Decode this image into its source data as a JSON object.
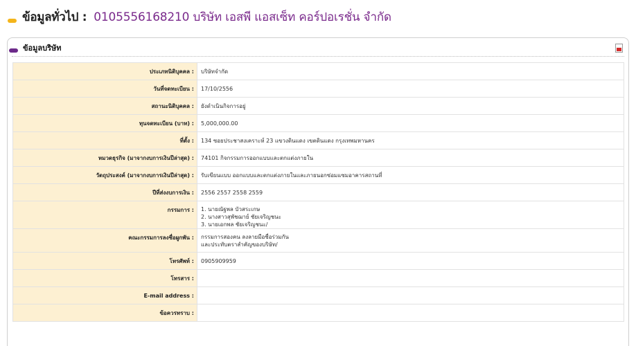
{
  "header": {
    "title": "ข้อมูลทั่วไป :",
    "company": "0105556168210  บริษัท เอสพี แอสเซ็ท คอร์ปอเรชั่น จำกัด"
  },
  "panel": {
    "title": "ข้อมูลบริษัท",
    "pdf_icon": "pdf-icon"
  },
  "rows": [
    {
      "label": "ประเภทนิติบุคคล :",
      "value": "บริษัทจำกัด"
    },
    {
      "label": "วันที่จดทะเบียน :",
      "value": "17/10/2556"
    },
    {
      "label": "สถานะนิติบุคคล :",
      "value": "ยังดำเนินกิจการอยู่"
    },
    {
      "label": "ทุนจดทะเบียน (บาท) :",
      "value": "5,000,000.00"
    },
    {
      "label": "ที่ตั้ง :",
      "value": "134 ซอยประชาสงเคราะห์ 23 แขวงดินแดง เขตดินแดง กรุงเทพมหานคร"
    },
    {
      "label": "หมวดธุรกิจ (มาจากงบการเงินปีล่าสุด) :",
      "value": " 74101 กิจกรรมการออกแบบและตกแต่งภายใน"
    },
    {
      "label": "วัตถุประสงค์ (มาจากงบการเงินปีล่าสุด) :",
      "value": " รับเขียนแบบ ออกแบบและตกแต่งภายในและภายนอกซ่อมแซมอาคารสถานที่"
    },
    {
      "label": "ปีที่ส่งงบการเงิน :",
      "value": "2556 2557 2558 2559"
    },
    {
      "label": "กรรมการ :",
      "lines": [
        "1. นายณัฐพล บัวสระเกษ",
        "2. นางสาวสุพัชฌาย์ ชัยเจริญชนะ",
        "3. นายเอกพล ชัยเจริญชนะ/"
      ]
    },
    {
      "label": "คณะกรรมการลงชื่อผูกพัน :",
      "lines": [
        "กรรมการสองคน ลงลายมือชื่อร่วมกัน",
        "และประทับตราสำคัญของบริษัท/"
      ]
    },
    {
      "label": "โทรศัพท์ :",
      "value": "0905909959"
    },
    {
      "label": "โทรสาร :",
      "value": ""
    },
    {
      "label": "E-mail address :",
      "value": ""
    },
    {
      "label": "ข้อควรทราบ :",
      "value": ""
    }
  ]
}
